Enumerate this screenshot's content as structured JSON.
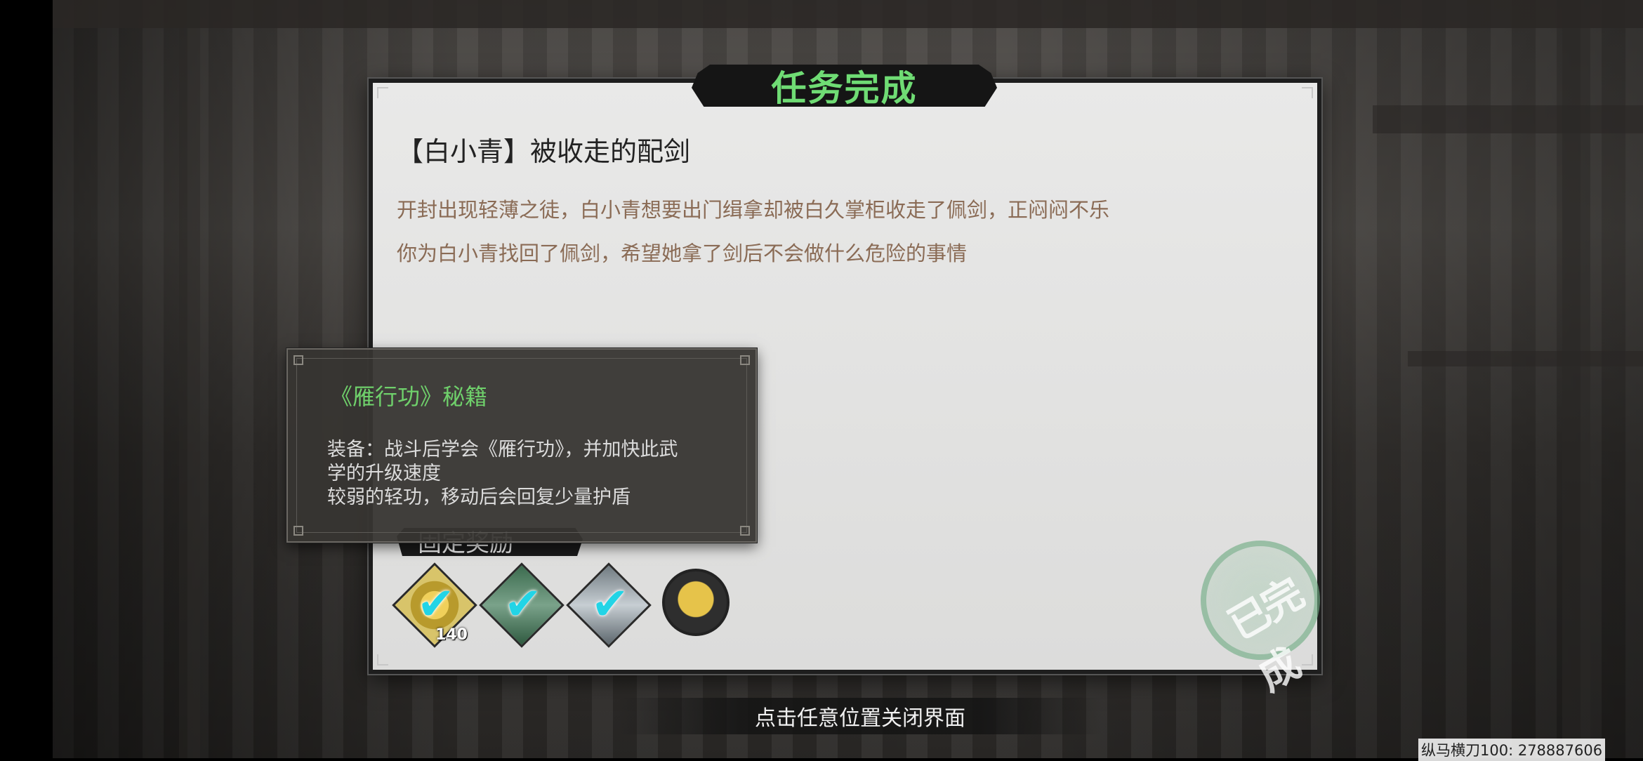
{
  "dialog": {
    "title": "任务完成",
    "quest_name": "【白小青】被收走的配剑",
    "description_lines": [
      "开封出现轻薄之徒，白小青想要出门缉拿却被白久掌柜收走了佩剑，正闷闷不乐",
      "你为白小青找回了佩剑，希望她拿了剑后不会做什么危险的事情"
    ],
    "reward_header": "固定奖励",
    "rewards": [
      {
        "icon": "gold-coin-icon",
        "count": "140",
        "claimed": true
      },
      {
        "icon": "book-icon",
        "count": "",
        "claimed": true
      },
      {
        "icon": "cloth-icon",
        "count": "",
        "claimed": true
      },
      {
        "icon": "character-portrait-icon",
        "count": "",
        "claimed": false
      }
    ],
    "stamp_text": "已完成"
  },
  "tooltip": {
    "title": "《雁行功》秘籍",
    "lines": [
      "装备：战斗后学会《雁行功》，并加快此武",
      "学的升级速度",
      "较弱的轻功，移动后会回复少量护盾"
    ]
  },
  "hint": "点击任意位置关闭界面",
  "watermark": "纵马横刀100: 278887606",
  "colors": {
    "title_green": "#6fdc74",
    "tooltip_title_green": "#6fd06b",
    "description_brown": "#8a6b55",
    "check_cyan": "#22d4e6"
  }
}
